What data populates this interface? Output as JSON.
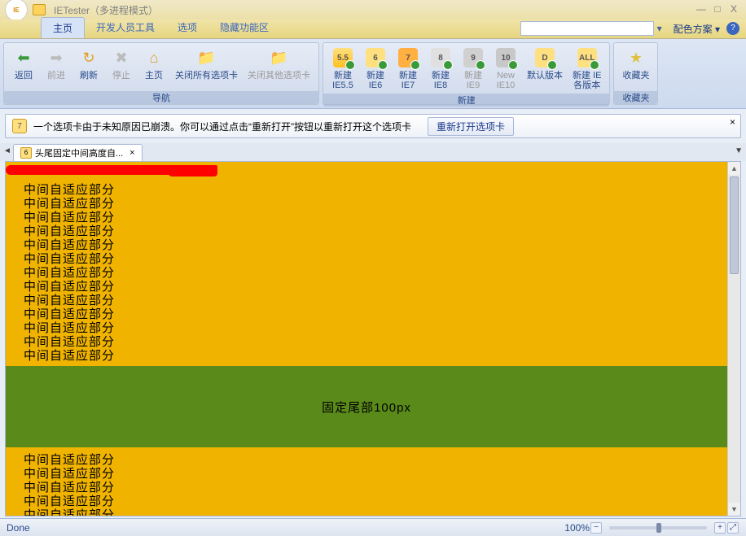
{
  "app": {
    "title": "IETester（多进程模式）",
    "logo": "IE"
  },
  "window_buttons": {
    "min": "—",
    "max": "□",
    "close": "X"
  },
  "ribbon_tabs": {
    "items": [
      "主页",
      "开发人员工具",
      "选项",
      "隐藏功能区"
    ],
    "active_index": 0,
    "color_scheme": "配色方案",
    "help": "?"
  },
  "groups": {
    "nav": {
      "label": "导航",
      "buttons": [
        {
          "label": "返回",
          "icon": "⬅",
          "dis": false,
          "color": "#3a9a3a"
        },
        {
          "label": "前进",
          "icon": "➡",
          "dis": true,
          "color": "#bbb"
        },
        {
          "label": "刷新",
          "icon": "↻",
          "dis": false,
          "color": "#e0a020"
        },
        {
          "label": "停止",
          "icon": "✖",
          "dis": true,
          "color": "#bbb"
        },
        {
          "label": "主页",
          "icon": "⌂",
          "dis": false,
          "color": "#e0a020"
        },
        {
          "label": "关闭所有选项卡",
          "icon": "📁",
          "dis": false,
          "color": "#e0a020"
        },
        {
          "label": "关闭其他选项卡",
          "icon": "📁",
          "dis": true,
          "color": "#bbb"
        }
      ]
    },
    "new": {
      "label": "新建",
      "buttons": [
        {
          "label": "新建\nIE5.5",
          "tile": "5.5",
          "cls": "t55",
          "dis": false
        },
        {
          "label": "新建\nIE6",
          "tile": "6",
          "cls": "t6",
          "dis": false
        },
        {
          "label": "新建\nIE7",
          "tile": "7",
          "cls": "t7",
          "dis": false
        },
        {
          "label": "新建\nIE8",
          "tile": "8",
          "cls": "t8",
          "dis": false
        },
        {
          "label": "新建\nIE9",
          "tile": "9",
          "cls": "t9",
          "dis": true
        },
        {
          "label": "New\nIE10",
          "tile": "10",
          "cls": "t10",
          "dis": true
        },
        {
          "label": "默认版本",
          "tile": "D",
          "cls": "td",
          "dis": false
        },
        {
          "label": "新建 IE\n各版本",
          "tile": "ALL",
          "cls": "tall",
          "dis": false
        }
      ]
    },
    "fav": {
      "label": "收藏夹",
      "btn": {
        "label": "收藏夹",
        "icon": "★",
        "color": "#e0c040"
      }
    }
  },
  "message": {
    "icon": "7",
    "text": "一个选项卡由于未知原因已崩溃。你可以通过点击“重新打开”按钮以重新打开这个选项卡",
    "button": "重新打开选项卡",
    "close": "×"
  },
  "doc_tab": {
    "icon": "6",
    "title": "头尾固定中间高度自...",
    "close": "×"
  },
  "page": {
    "repeat_text": "中间自适应部分",
    "top_count": 13,
    "bottom_count": 5,
    "footer": "固定尾部100px"
  },
  "status": {
    "left": "Done",
    "zoom": "100%",
    "minus": "−",
    "plus": "+",
    "full": "⤢"
  }
}
